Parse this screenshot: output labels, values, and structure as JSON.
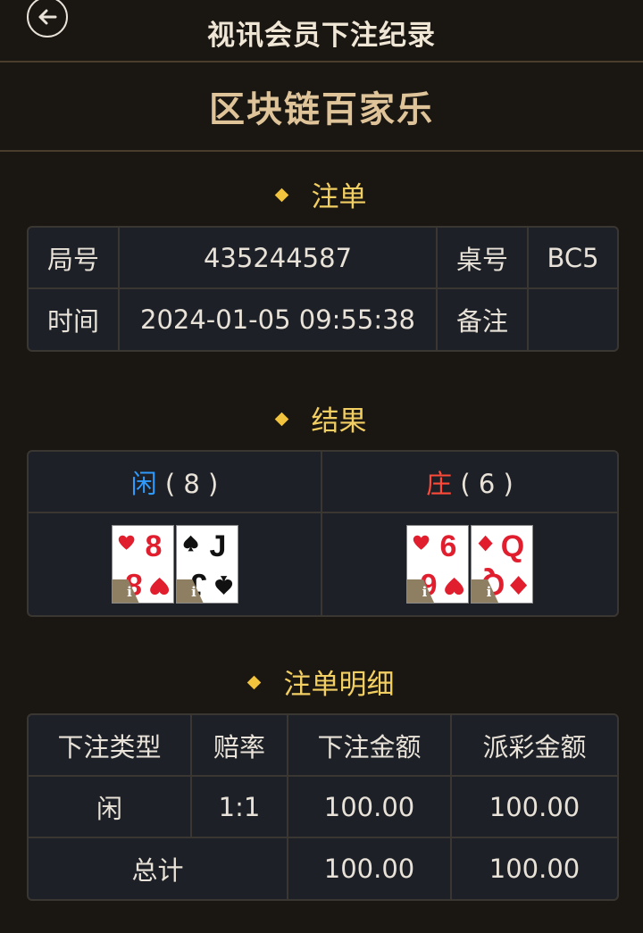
{
  "header": {
    "title": "视讯会员下注纪录"
  },
  "game": {
    "title": "区块链百家乐"
  },
  "sections": {
    "bet": "注单",
    "result": "结果",
    "detail": "注单明细"
  },
  "bet_info": {
    "round_label": "局号",
    "round_value": "435244587",
    "table_label": "桌号",
    "table_value": "BC5",
    "time_label": "时间",
    "time_value": "2024-01-05 09:55:38",
    "note_label": "备注",
    "note_value": ""
  },
  "result": {
    "player": {
      "label": "闲",
      "score": "( 8 )",
      "cards": [
        {
          "rank": "8",
          "suit": "hearts",
          "suit_icon": "heart-icon",
          "color": "#e01e2e"
        },
        {
          "rank": "J",
          "suit": "spades",
          "suit_icon": "spade-icon",
          "color": "#111111"
        }
      ]
    },
    "banker": {
      "label": "庄",
      "score": "( 6 )",
      "cards": [
        {
          "rank": "6",
          "suit": "hearts",
          "suit_icon": "heart-icon",
          "color": "#e01e2e"
        },
        {
          "rank": "Q",
          "suit": "diamonds",
          "suit_icon": "diamond-icon",
          "color": "#e01e2e"
        }
      ]
    },
    "card_badge": "i"
  },
  "detail": {
    "headers": [
      "下注类型",
      "赔率",
      "下注金额",
      "派彩金额"
    ],
    "rows": [
      {
        "type": "闲",
        "odds": "1:1",
        "bet": "100.00",
        "payout": "100.00"
      }
    ],
    "total": {
      "label": "总计",
      "bet": "100.00",
      "payout": "100.00"
    }
  },
  "colors": {
    "gold": "#dfc49a",
    "diamond": "#f2c33c",
    "player": "#2f9bff",
    "banker": "#ff4a3a",
    "odds": "#d7252a"
  }
}
